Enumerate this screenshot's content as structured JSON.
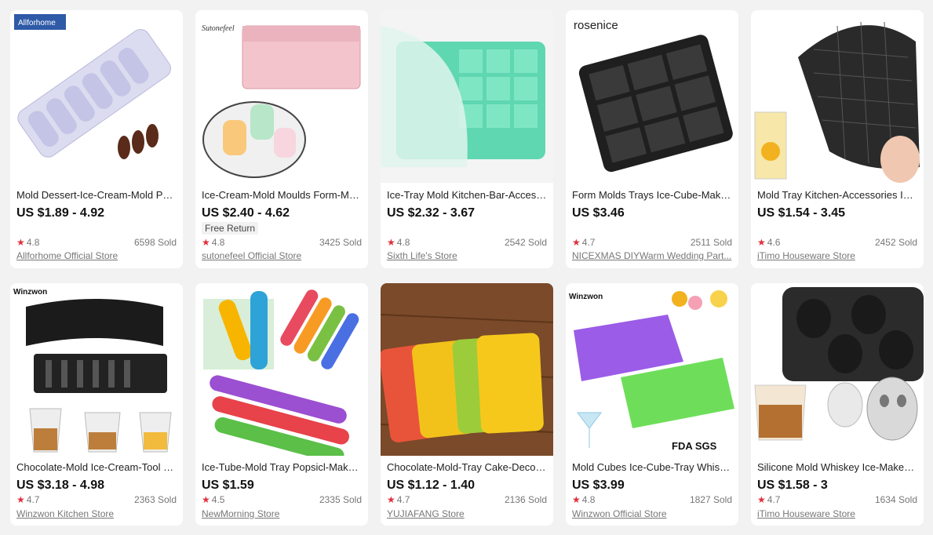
{
  "products": [
    {
      "title": "Mold Dessert-Ice-Cream-Mold Pop...",
      "price": "US $1.89 - 4.92",
      "rating": "4.8",
      "sold": "6598 Sold",
      "store": "Allforhome Official Store",
      "brand": "Allforhome"
    },
    {
      "title": "Ice-Cream-Mold Moulds Form-Mak...",
      "price": "US $2.40 - 4.62",
      "badge": "Free Return",
      "rating": "4.8",
      "sold": "3425 Sold",
      "store": "sutonefeel Official Store",
      "brand": "Sutonefeel"
    },
    {
      "title": "Ice-Tray Mold Kitchen-Bar-Accesso...",
      "price": "US $2.32 - 3.67",
      "rating": "4.8",
      "sold": "2542 Sold",
      "store": "Sixth Life's Store"
    },
    {
      "title": "Form Molds Trays Ice-Cube-Maker ...",
      "price": "US $3.46",
      "rating": "4.7",
      "sold": "2511 Sold",
      "store": "NICEXMAS DIYWarm Wedding Part...",
      "brand": "rosenice"
    },
    {
      "title": "Mold Tray Kitchen-Accessories Ice-...",
      "price": "US $1.54 - 3.45",
      "rating": "4.6",
      "sold": "2452 Sold",
      "store": "iTimo Houseware Store"
    },
    {
      "title": "Chocolate-Mold Ice-Cream-Tool W...",
      "price": "US $3.18 - 4.98",
      "rating": "4.7",
      "sold": "2363 Sold",
      "store": "Winzwon Kitchen Store",
      "brand": "Winzwon"
    },
    {
      "title": "Ice-Tube-Mold Tray Popsicl-Maker ...",
      "price": "US $1.59",
      "rating": "4.5",
      "sold": "2335 Sold",
      "store": "NewMorning Store"
    },
    {
      "title": "Chocolate-Mold-Tray Cake-Decora...",
      "price": "US $1.12 - 1.40",
      "rating": "4.7",
      "sold": "2136 Sold",
      "store": "YUJIAFANG Store"
    },
    {
      "title": "Mold Cubes Ice-Cube-Tray Whiske...",
      "price": "US $3.99",
      "rating": "4.8",
      "sold": "1827 Sold",
      "store": "Winzwon Official Store",
      "brand": "Winzwon",
      "cert": "FDA SGS"
    },
    {
      "title": "Silicone Mold Whiskey Ice-Maker K...",
      "price": "US $1.58 - 3",
      "rating": "4.7",
      "sold": "1634 Sold",
      "store": "iTimo Houseware Store"
    }
  ],
  "icons": {
    "star": "star-icon"
  },
  "colors": {
    "star": "#e0313c",
    "background": "#f2f2f2"
  }
}
